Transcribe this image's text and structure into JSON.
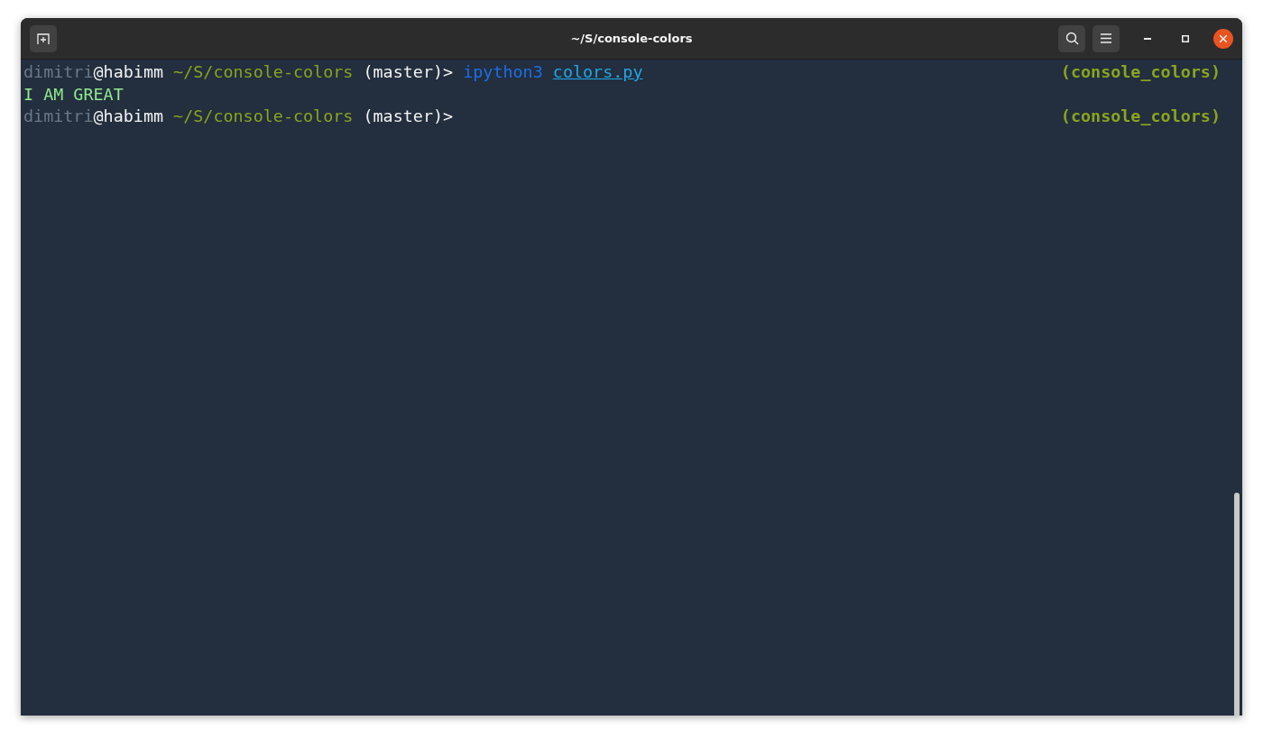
{
  "window": {
    "title": "~/S/console-colors"
  },
  "lines": [
    {
      "segments": [
        {
          "kind": "user",
          "text": "dimitri",
          "space_before": false
        },
        {
          "kind": "host",
          "text": "@habimm",
          "space_before": false
        },
        {
          "kind": "path",
          "text": "~/S/console-colors",
          "space_before": true
        },
        {
          "kind": "plain",
          "text": "(master)>",
          "space_before": true
        },
        {
          "kind": "command",
          "text": "ipython3",
          "space_before": true
        },
        {
          "kind": "link",
          "text": "colors.py",
          "space_before": true
        }
      ],
      "right": "(console_colors)"
    },
    {
      "segments": [
        {
          "kind": "output",
          "text": "I AM GREAT",
          "space_before": false
        }
      ]
    },
    {
      "segments": [
        {
          "kind": "user",
          "text": "dimitri",
          "space_before": false
        },
        {
          "kind": "host",
          "text": "@habimm",
          "space_before": false
        },
        {
          "kind": "path",
          "text": "~/S/console-colors",
          "space_before": true
        },
        {
          "kind": "plain",
          "text": "(master)>",
          "space_before": true
        }
      ],
      "right": "(console_colors)"
    }
  ]
}
